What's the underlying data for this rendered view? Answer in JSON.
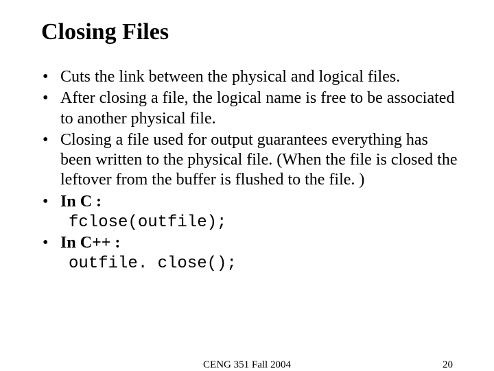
{
  "title": "Closing Files",
  "bullets": {
    "b1": "Cuts the link between the physical and logical files.",
    "b2": "After closing a file, the logical name is free to be associated to another physical file.",
    "b3": "Closing a file used for output guarantees everything has been written to the physical file. (When the file is closed the leftover from the buffer is flushed to the file. )",
    "b4": "In C :",
    "b5": "In C++ :"
  },
  "code": {
    "c1": "fclose(outfile);",
    "c2": "outfile. close();"
  },
  "footer": {
    "course": "CENG 351 Fall 2004",
    "page": "20"
  }
}
